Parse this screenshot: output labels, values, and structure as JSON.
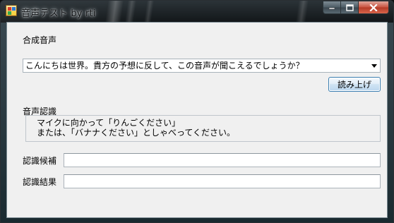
{
  "window": {
    "title": "音声テスト by rti",
    "icon": "app-icon",
    "controls": {
      "minimize_icon": "minimize-icon",
      "maximize_icon": "maximize-icon",
      "close_icon": "close-icon"
    }
  },
  "synthesis": {
    "label": "合成音声",
    "combo_value": "こんにちは世界。貴方の予想に反して、この音声が聞こえるでしょうか？",
    "read_button": "読み上げ"
  },
  "recognition": {
    "label": "音声認識",
    "instruction_line1": "マイクに向かって「りんごください」",
    "instruction_line2": "または、「バナナください」としゃべってください。",
    "candidate_label": "認識候補",
    "candidate_value": "",
    "result_label": "認識結果",
    "result_value": ""
  }
}
